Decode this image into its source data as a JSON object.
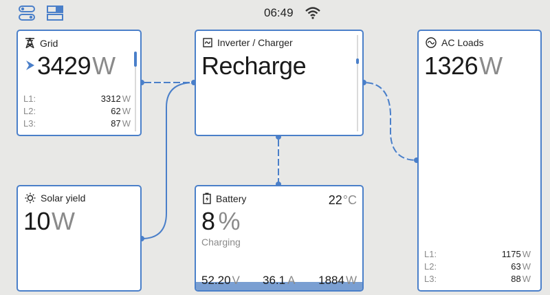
{
  "topbar": {
    "left_icon_1": "toggle-switches-icon",
    "left_icon_2": "panels-layout-icon",
    "time": "06:49",
    "wifi_icon": "wifi-icon"
  },
  "grid": {
    "icon": "power-pylon-icon",
    "title": "Grid",
    "value": "3429",
    "unit": "W",
    "direction_icon": "flow-arrow-icon",
    "phases": [
      {
        "label": "L1:",
        "value": "3312",
        "unit": "W"
      },
      {
        "label": "L2:",
        "value": "62",
        "unit": "W"
      },
      {
        "label": "L3:",
        "value": "87",
        "unit": "W"
      }
    ]
  },
  "inverter": {
    "icon": "inverter-icon",
    "title": "Inverter / Charger",
    "state": "Recharge"
  },
  "ac_loads": {
    "icon": "sine-wave-icon",
    "title": "AC Loads",
    "value": "1326",
    "unit": "W",
    "phases": [
      {
        "label": "L1:",
        "value": "1175",
        "unit": "W"
      },
      {
        "label": "L2:",
        "value": "63",
        "unit": "W"
      },
      {
        "label": "L3:",
        "value": "88",
        "unit": "W"
      }
    ]
  },
  "solar": {
    "icon": "sun-icon",
    "title": "Solar yield",
    "value": "10",
    "unit": "W"
  },
  "battery": {
    "icon": "battery-charging-icon",
    "title": "Battery",
    "temperature": "22",
    "temperature_unit": "°C",
    "soc": "8",
    "soc_unit": "%",
    "status": "Charging",
    "soc_fraction": 0.08,
    "voltage": "52.20",
    "voltage_unit": "V",
    "current": "36.1",
    "current_unit": "A",
    "power": "1884",
    "power_unit": "W"
  },
  "colors": {
    "accent": "#4a7fc9",
    "background": "#e8e8e6",
    "card": "#ffffff",
    "muted_text": "#8a8a8a"
  }
}
